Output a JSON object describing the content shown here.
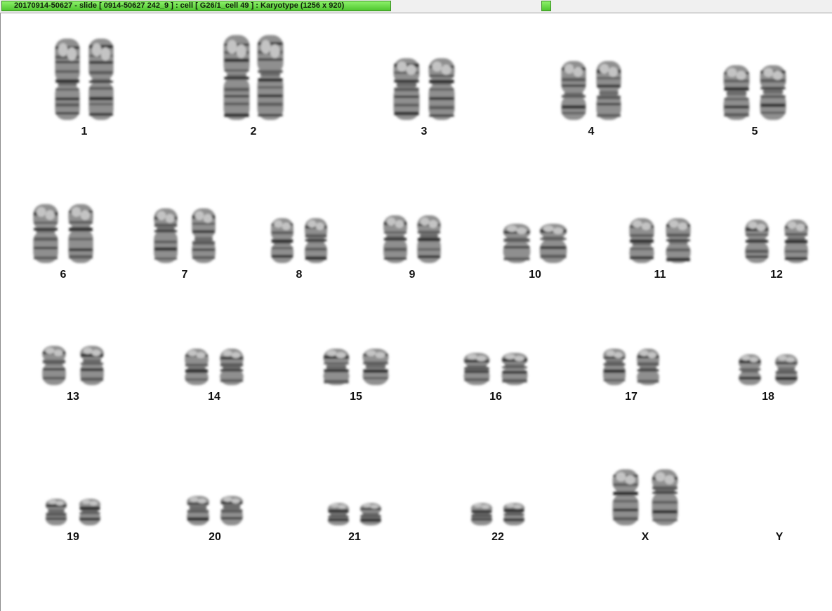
{
  "window": {
    "title": "20170914-50627 - slide [ 0914-50627 242_9 ] : cell [ G26/1_cell 49 ] : Karyotype  (1256 x 920)"
  },
  "karyotype": {
    "pairs": [
      {
        "label": "1"
      },
      {
        "label": "2"
      },
      {
        "label": "3"
      },
      {
        "label": "4"
      },
      {
        "label": "5"
      },
      {
        "label": "6"
      },
      {
        "label": "7"
      },
      {
        "label": "8"
      },
      {
        "label": "9"
      },
      {
        "label": "10"
      },
      {
        "label": "11"
      },
      {
        "label": "12"
      },
      {
        "label": "13"
      },
      {
        "label": "14"
      },
      {
        "label": "15"
      },
      {
        "label": "16"
      },
      {
        "label": "17"
      },
      {
        "label": "18"
      },
      {
        "label": "19"
      },
      {
        "label": "20"
      },
      {
        "label": "21"
      },
      {
        "label": "22"
      },
      {
        "label": "X"
      },
      {
        "label": "Y"
      }
    ]
  }
}
